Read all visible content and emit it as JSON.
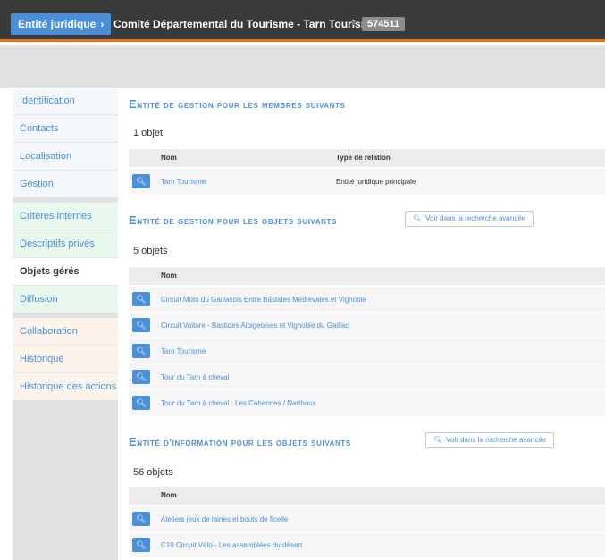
{
  "header": {
    "breadcrumb_label": "Entité juridique",
    "title": "Comité Départemental du Tourisme - Tarn Tourisme",
    "id_badge": "574511"
  },
  "sidebar": {
    "items": [
      {
        "label": "Identification"
      },
      {
        "label": "Contacts"
      },
      {
        "label": "Localisation"
      },
      {
        "label": "Gestion"
      },
      {
        "label": "Critères internes"
      },
      {
        "label": "Descriptifs privés"
      },
      {
        "label": "Objets gérés"
      },
      {
        "label": "Diffusion"
      },
      {
        "label": "Collaboration"
      },
      {
        "label": "Historique"
      },
      {
        "label": "Historique des actions"
      }
    ]
  },
  "sections": {
    "members": {
      "title_first": "E",
      "title_rest": "ntité de gestion pour les membres suivants",
      "count": "1 objet",
      "col_name": "Nom",
      "col_rel": "Type de relation",
      "rows": [
        {
          "name": "Tarn Tourisme",
          "relation": "Entité juridique principale"
        }
      ]
    },
    "managed": {
      "title_first": "E",
      "title_rest": "ntité de gestion pour les objets suivants",
      "adv_label": "Voir dans la recherche avancée",
      "count": "5 objets",
      "col_name": "Nom",
      "rows": [
        {
          "name": "Circuit Moto du Gaillacois Entre Bastides Médiévales et Vignoble"
        },
        {
          "name": "Circuit Voiture - Bastides Albigeoises et Vignoble du Gaillac"
        },
        {
          "name": "Tarn Tourisme"
        },
        {
          "name": "Tour du Tarn à cheval"
        },
        {
          "name": "Tour du Tarn à cheval : Les Cabannes / Narthoux"
        }
      ]
    },
    "info": {
      "title_first": "E",
      "title_rest": "ntité d'information pour les objets suivants",
      "adv_label": "Voir dans la recherche avancée",
      "count": "56 objets",
      "col_name": "Nom",
      "rows": [
        {
          "name": "Ateliers jeux de laines et bouts de ficelle"
        },
        {
          "name": "C10 Circuit Vélo - Les assemblées du désert"
        }
      ]
    }
  },
  "icons": {
    "view": "magnifier-icon",
    "chevron": "chevron-right-icon"
  },
  "colors": {
    "accent": "#4a90d9",
    "topbar": "#3a3a3a",
    "topbar_border": "#e8711c"
  }
}
